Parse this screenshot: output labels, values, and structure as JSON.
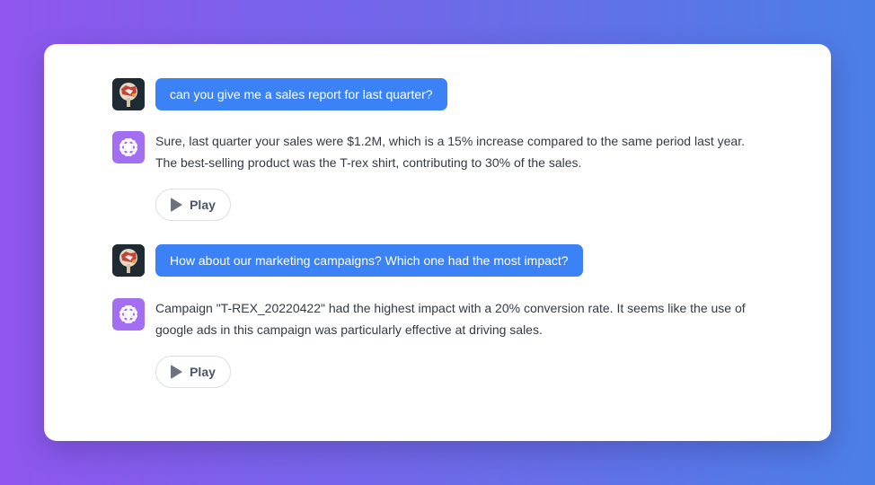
{
  "conversation": {
    "messages": [
      {
        "role": "user",
        "text": "can you give me a sales report for last quarter?"
      },
      {
        "role": "assistant",
        "text": "Sure, last quarter your sales were $1.2M, which is a 15% increase compared to the same period last year. The best-selling product was the T-rex shirt, contributing to 30% of the sales.",
        "play_label": "Play"
      },
      {
        "role": "user",
        "text": "How about our marketing campaigns? Which one had the most impact?"
      },
      {
        "role": "assistant",
        "text": "Campaign \"T-REX_20220422\" had the highest impact with a 20% conversion rate. It seems like the use of google ads in this campaign was particularly effective at driving sales.",
        "play_label": "Play"
      }
    ]
  },
  "icons": {
    "user_avatar": "user-avatar-icon",
    "assistant_avatar": "openai-logo-icon",
    "play": "play-icon"
  },
  "colors": {
    "user_bubble": "#3b82f6",
    "assistant_avatar_bg": "#a46ef2",
    "background_start": "#8f56ee",
    "background_end": "#4b7fe6"
  }
}
